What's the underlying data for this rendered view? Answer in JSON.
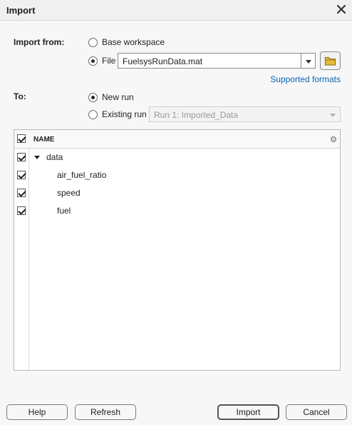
{
  "window": {
    "title": "Import",
    "close_icon": "close-icon"
  },
  "import_from": {
    "label": "Import from:",
    "base_workspace_label": "Base workspace",
    "file_label": "File",
    "file_value": "FuelsysRunData.mat",
    "selected": "file",
    "supported_formats_link": "Supported formats",
    "folder_icon": "folder-icon"
  },
  "to": {
    "label": "To:",
    "new_run_label": "New run",
    "existing_run_label": "Existing run",
    "existing_run_value": "Run 1: Imported_Data",
    "selected": "new_run"
  },
  "table": {
    "header_name": "NAME",
    "all_checked": true,
    "rows": [
      {
        "label": "data",
        "checked": true,
        "expanded": true,
        "level": 0
      },
      {
        "label": "air_fuel_ratio",
        "checked": true,
        "level": 1
      },
      {
        "label": "speed",
        "checked": true,
        "level": 1
      },
      {
        "label": "fuel",
        "checked": true,
        "level": 1
      }
    ]
  },
  "buttons": {
    "help": "Help",
    "refresh": "Refresh",
    "import": "Import",
    "cancel": "Cancel"
  },
  "colors": {
    "link": "#0b64b6",
    "folder": "#e8b93a"
  }
}
